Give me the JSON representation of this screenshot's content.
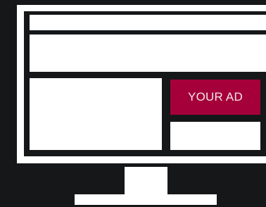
{
  "ad": {
    "label": "YOUR AD",
    "color": "#a5003a"
  },
  "colors": {
    "background": "#151719",
    "monitor": "#ffffff"
  },
  "icons": {
    "illustration": "monitor-with-ad-layout-icon"
  }
}
